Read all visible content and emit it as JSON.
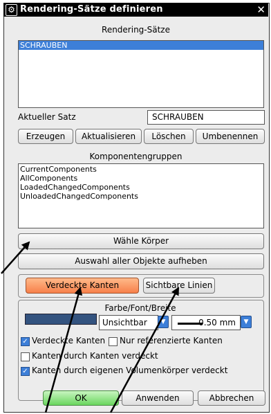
{
  "dialog": {
    "title": "Rendering-Sätze definieren",
    "icon": "gear-icon",
    "close_icon": "close-icon"
  },
  "sets": {
    "heading": "Rendering-Sätze",
    "items": [
      "SCHRAUBEN"
    ],
    "current_label": "Aktueller Satz",
    "current_value": "SCHRAUBEN",
    "buttons": {
      "create": "Erzeugen",
      "update": "Aktualisieren",
      "delete": "Löschen",
      "rename": "Umbenennen"
    }
  },
  "component_groups": {
    "heading": "Komponentengruppen",
    "items": [
      "CurrentComponents",
      "AllComponents",
      "LoadedChangedComponents",
      "UnloadedChangedComponents"
    ]
  },
  "actions": {
    "select_bodies": "Wähle Körper",
    "deselect_all": "Auswahl aller Objekte aufheben"
  },
  "tabs": {
    "hidden_edges": "Verdeckte Kanten",
    "visible_lines": "Sichtbare Linien",
    "active": "hidden_edges"
  },
  "style": {
    "heading": "Farbe/Font/Breite",
    "color_hex": "#33537f",
    "font_value": "Unsichtbar",
    "width_value": "0.50 mm"
  },
  "options": {
    "hidden_edges": {
      "label": "Verdeckte Kanten",
      "checked": true
    },
    "referenced_only": {
      "label": "Nur referenzierte Kanten",
      "checked": false
    },
    "edges_by_edges": {
      "label": "Kanten durch Kanten verdeckt",
      "checked": false
    },
    "edges_by_own_solid": {
      "label": "Kanten durch eigenen Volumenkörper verdeckt",
      "checked": true
    }
  },
  "footer": {
    "ok": "OK",
    "apply": "Anwenden",
    "cancel": "Abbrechen"
  },
  "colors": {
    "accent": "#3d7fd8",
    "active_tab": "#f7804a",
    "ok_button": "#6ad65e"
  }
}
